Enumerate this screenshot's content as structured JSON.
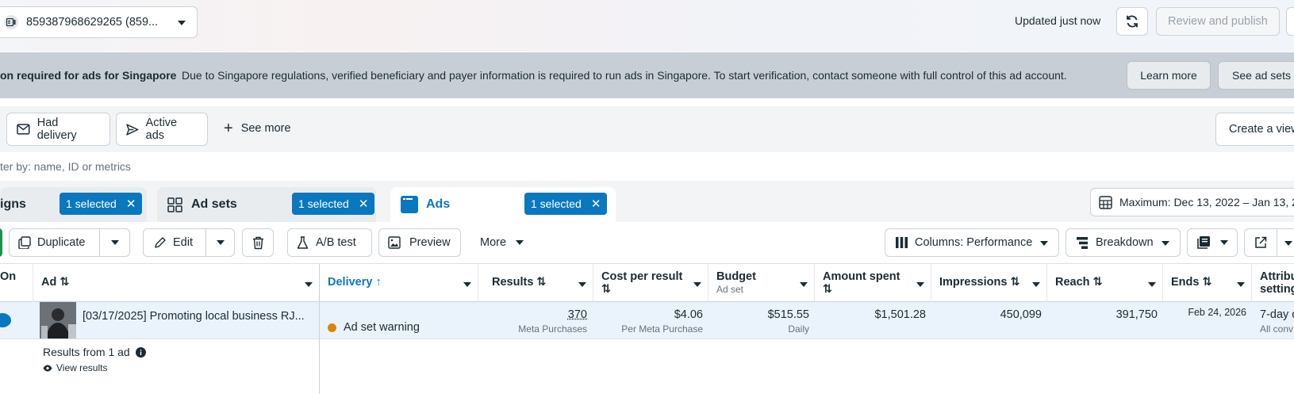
{
  "topbar": {
    "account": "859387968629265 (859...",
    "updated": "Updated just now",
    "review_publish": "Review and publish"
  },
  "banner": {
    "title": "on required for ads for Singapore",
    "message": "Due to Singapore regulations, verified beneficiary and payer information is required to run ads in Singapore. To start verification, contact someone with full control of this ad account.",
    "learn_more": "Learn more",
    "see_ad_sets": "See ad sets"
  },
  "filters": {
    "had_delivery": "Had delivery",
    "active_ads": "Active ads",
    "see_more": "See more",
    "create_view": "Create a view",
    "search_placeholder": "ter by: name, ID or metrics"
  },
  "tabs": {
    "campaigns": "igns",
    "ad_sets": "Ad sets",
    "ads": "Ads",
    "selected_badge": "1 selected",
    "date_range": "Maximum: Dec 13, 2022 – Jan 13, 2"
  },
  "toolbar": {
    "duplicate": "Duplicate",
    "edit": "Edit",
    "ab_test": "A/B test",
    "preview": "Preview",
    "more": "More",
    "columns": "Columns: Performance",
    "breakdown": "Breakdown"
  },
  "table": {
    "headers": {
      "on": "On",
      "ad": "Ad",
      "delivery": "Delivery",
      "results": "Results",
      "cost_per_result": "Cost per result",
      "budget": "Budget",
      "budget_sub": "Ad set",
      "amount_spent": "Amount spent",
      "impressions": "Impressions",
      "reach": "Reach",
      "ends": "Ends",
      "attribution": "Attribu",
      "attribution_2": "setting"
    },
    "row": {
      "ad_name": "[03/17/2025] Promoting local business RJ...",
      "delivery": "Ad set warning",
      "results": "370",
      "results_sub": "Meta Purchases",
      "cost_per_result": "$4.06",
      "cost_sub": "Per Meta Purchase",
      "budget": "$515.55",
      "budget_sub": "Daily",
      "amount_spent": "$1,501.28",
      "impressions": "450,099",
      "reach": "391,750",
      "ends": "Feb 24, 2026",
      "attribution": "7-day c",
      "attribution_sub": "All conv"
    },
    "summary": "Results from 1 ad",
    "view_results": "View results"
  },
  "colors": {
    "accent": "#0a78be",
    "banner_bg": "#c8ced5",
    "warning": "#d9850c",
    "toggle_on": "#0a78be"
  }
}
